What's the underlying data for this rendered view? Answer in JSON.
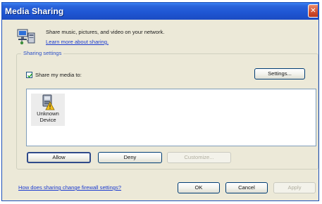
{
  "window": {
    "title": "Media Sharing",
    "close_icon": "close-icon"
  },
  "header": {
    "icon": "media-network-icon",
    "description": "Share music, pictures, and video on your network.",
    "learn_more_link": "Learn more about sharing."
  },
  "sharing_settings": {
    "group_label": "Sharing settings",
    "share_checkbox_label": "Share my media to:",
    "share_checked": true,
    "settings_button": "Settings...",
    "devices": [
      {
        "icon": "unknown-device-warning-icon",
        "label_line1": "Unknown",
        "label_line2": "Device"
      }
    ],
    "allow_button": "Allow",
    "deny_button": "Deny",
    "customize_button": "Customize..."
  },
  "footer": {
    "firewall_link": "How does sharing change firewall settings?",
    "ok_button": "OK",
    "cancel_button": "Cancel",
    "apply_button": "Apply"
  },
  "colors": {
    "title_bar": "#1f57d4",
    "dialog_background": "#ece9d8",
    "link": "#1a3ad0",
    "group_label": "#2b4fc7",
    "close_button": "#d24e2e"
  }
}
